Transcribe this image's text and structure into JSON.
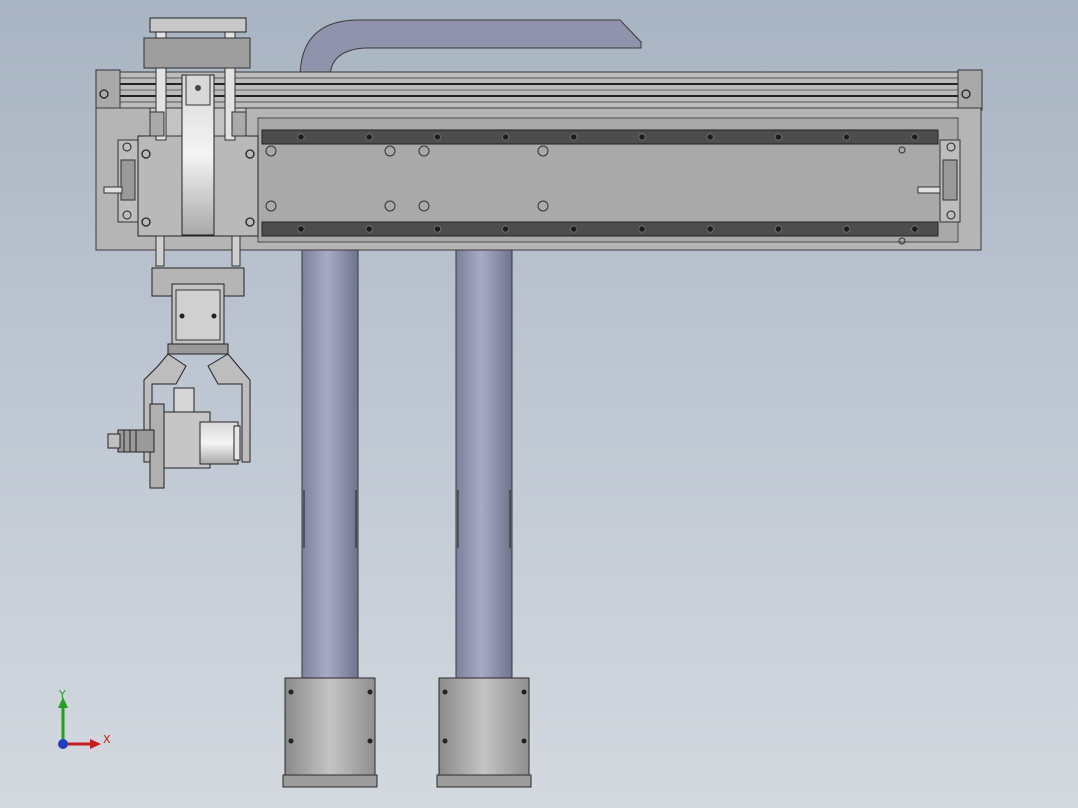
{
  "view": {
    "background_top": "#a9b4c2",
    "background_bottom": "#d4d9df"
  },
  "triad": {
    "x_label": "X",
    "y_label": "Y",
    "x_color": "#c41e1e",
    "y_color": "#22a022",
    "z_color": "#1f3fbf"
  },
  "model": {
    "frame_color": "#b4b4b4",
    "rail_color": "#4a4a4a",
    "column_color": "#8f93ab",
    "base_color": "#a9a9a9"
  }
}
